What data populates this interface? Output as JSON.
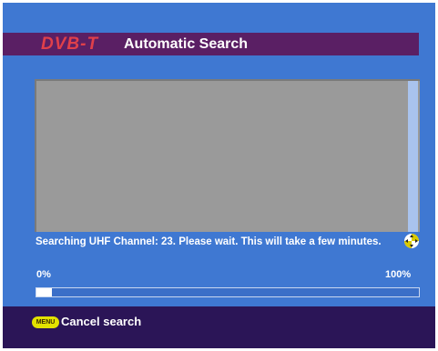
{
  "header": {
    "logo_text": "DVB-T",
    "title": "Automatic Search"
  },
  "search": {
    "status_text": "Searching UHF Channel: 23. Please wait. This will take a few minutes.",
    "progress_start_label": "0%",
    "progress_end_label": "100%",
    "progress_fraction": 0.04
  },
  "footer": {
    "menu_button_label": "MENU",
    "cancel_label": "Cancel search"
  },
  "colors": {
    "background": "#3f78d2",
    "header_bar": "#5a1f64",
    "logo": "#e0404a",
    "panel": "#9a9a9a",
    "footer": "#2b1557",
    "menu_button": "#e2e200"
  },
  "icons": {
    "navigation": "four-way-arrows-icon"
  }
}
